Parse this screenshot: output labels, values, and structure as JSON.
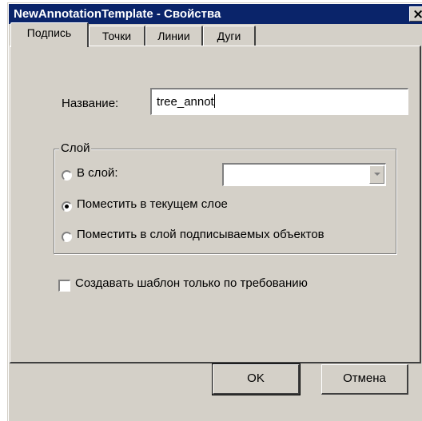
{
  "window": {
    "title": "NewAnnotationTemplate - Свойства",
    "close_glyph": "×"
  },
  "tabs": [
    {
      "label": "Подпись",
      "active": true
    },
    {
      "label": "Точки",
      "active": false
    },
    {
      "label": "Линии",
      "active": false
    },
    {
      "label": "Дуги",
      "active": false
    }
  ],
  "name_field": {
    "label": "Название:",
    "value": "tree_annot"
  },
  "layer_group": {
    "title": "Слой",
    "options": [
      {
        "label": "В слой:",
        "selected": false
      },
      {
        "label": "Поместить в текущем слое",
        "selected": true
      },
      {
        "label": "Поместить в слой подписываемых объектов",
        "selected": false
      }
    ],
    "layer_select_value": ""
  },
  "on_demand_checkbox": {
    "label": "Создавать шаблон только по требованию",
    "checked": false
  },
  "buttons": {
    "ok": "OK",
    "cancel": "Отмена"
  },
  "colors": {
    "titlebar": "#0a246a",
    "face": "#d4d0c8"
  }
}
